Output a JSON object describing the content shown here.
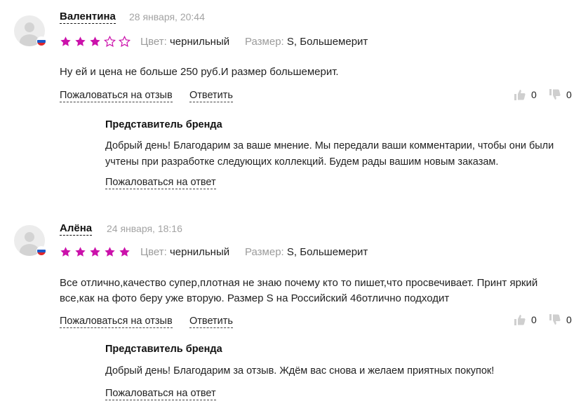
{
  "colors": {
    "star_filled": "#cb11ab",
    "star_empty": "#cb11ab",
    "muted": "#a3a3a3"
  },
  "labels": {
    "color": "Цвет:",
    "size": "Размер:",
    "complain_review": "Пожаловаться на отзыв",
    "reply": "Ответить",
    "brand_rep": "Представитель бренда",
    "complain_answer": "Пожаловаться на ответ"
  },
  "reviews": [
    {
      "author": "Валентина",
      "date": "28 января, 20:44",
      "rating": 3,
      "color_value": "чернильный",
      "size_value": "S, Большемерит",
      "text": "Ну ей и цена не больше 250 руб.И размер большемерит.",
      "likes": "0",
      "dislikes": "0",
      "brand_reply": "Добрый день! Благодарим за ваше мнение. Мы передали ваши комментарии, чтобы они были учтены при разработке следующих коллекций. Будем рады вашим новым заказам."
    },
    {
      "author": "Алёна",
      "date": "24 января, 18:16",
      "rating": 5,
      "color_value": "чернильный",
      "size_value": "S, Большемерит",
      "text": "Все отлично,качество супер,плотная не знаю почему кто то пишет,что просвечивает. Принт яркий все,как на фото беру уже вторую. Размер S на Российский 46отлично подходит",
      "likes": "0",
      "dislikes": "0",
      "brand_reply": "Добрый день! Благодарим за отзыв. Ждём вас снова и желаем приятных покупок!"
    }
  ]
}
